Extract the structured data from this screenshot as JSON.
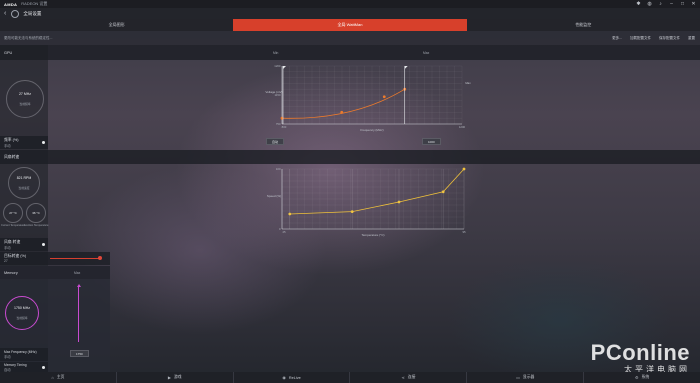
{
  "app": {
    "brand": "AMDA",
    "brand_sub": "RADEON 设置",
    "top_icons": [
      "bug-icon",
      "globe-icon",
      "bell-icon",
      "minimize-icon",
      "maximize-icon",
      "close-icon"
    ]
  },
  "nav": {
    "back": "‹",
    "title": "全局设置"
  },
  "tabs": [
    {
      "label": "全局图形",
      "active": false
    },
    {
      "label": "全局 WattMan",
      "active": true
    },
    {
      "label": "性能监控",
      "active": false
    }
  ],
  "subbar": {
    "hint": "更改可能无法与系统的稳定性...",
    "actions": [
      "更多...",
      "加载配置文件",
      "保存配置文件",
      "重置"
    ]
  },
  "gpu_section": {
    "title": "GPU",
    "min_label": "Min",
    "max_label": "Max",
    "gauge_value": "27 MHz",
    "gauge_caption": "当前频率",
    "control_label": "频率 (%)",
    "control_value": "手动",
    "btn_left": "自动",
    "btn_right": "1000"
  },
  "fan_section": {
    "title": "风扇转速",
    "gauge_value": "821 RPM",
    "gauge_caption": "当前速度",
    "temp1_value": "27 °C",
    "temp1_caption": "Current Temperature",
    "temp2_value": "36 °C",
    "temp2_caption": "Junction Temperature",
    "control_label": "风扇 转速",
    "control_value": "手动",
    "slider_label": "目标转速 (%)",
    "slider_value": "27"
  },
  "memory_section": {
    "title": "Memory",
    "max_label": "Max",
    "gauge_value": "1750 MHz",
    "gauge_caption": "当前频率",
    "freq_label": "Max Frequency (MHz)",
    "freq_value": "手动",
    "freq_btn": "1750",
    "timing_label": "Memory Timing",
    "timing_value": "自动"
  },
  "bottom_bar": [
    {
      "icon": "home-icon",
      "label": "主页"
    },
    {
      "icon": "play-icon",
      "label": "游戏"
    },
    {
      "icon": "relive-icon",
      "label": "ReLive"
    },
    {
      "icon": "share-icon",
      "label": "连接"
    },
    {
      "icon": "display-icon",
      "label": "显示器"
    },
    {
      "icon": "gear-icon",
      "label": "系统"
    }
  ],
  "watermark": {
    "main": "PConline",
    "sub": "太平洋电脑网"
  },
  "chart_data": [
    {
      "type": "line",
      "title": "",
      "xlabel": "Frequency (MHz)",
      "ylabel": "Voltage (mV)",
      "x_tick_labels": [
        "800",
        "1200"
      ],
      "y_tick_labels": [
        "1200",
        "1150",
        "750"
      ],
      "marker_left_label": "Min",
      "marker_right_label": "Max",
      "series": [
        {
          "x": [
            800,
            946,
            1050,
            1100
          ],
          "y": [
            750,
            801,
            935,
            1000
          ]
        }
      ],
      "xlim": [
        800,
        1240
      ],
      "ylim": [
        700,
        1200
      ],
      "accent": "#ec7a2c"
    },
    {
      "type": "line",
      "title": "",
      "xlabel": "Temperature (°C)",
      "ylabel": "Speed (%)",
      "x_tick_labels": [
        "25",
        "95"
      ],
      "y_tick_labels": [
        "100",
        "0"
      ],
      "series": [
        {
          "x": [
            28,
            52,
            70,
            87,
            95
          ],
          "y": [
            25,
            29,
            45,
            62,
            100
          ]
        }
      ],
      "xlim": [
        25,
        95
      ],
      "ylim": [
        0,
        100
      ],
      "accent": "#f0c23a"
    }
  ]
}
